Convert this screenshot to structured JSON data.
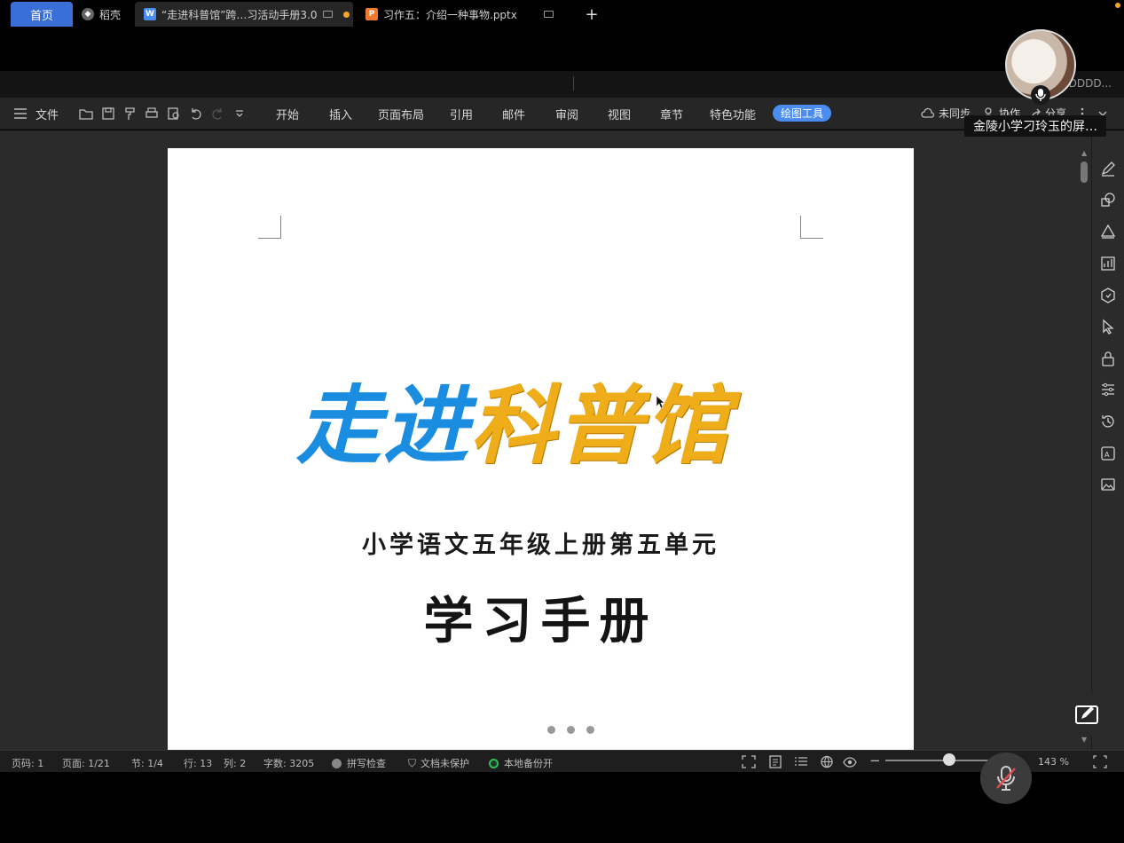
{
  "tabs": {
    "home": "首页",
    "daoke": "稻壳",
    "doc": "“走进科普馆”跨…习活动手册3.0",
    "ppt": "习作五：介绍一种事物.pptx",
    "new_tab": "+"
  },
  "account_text": "DDDD...",
  "toolbar": {
    "file": "文件",
    "menus": [
      "开始",
      "插入",
      "页面布局",
      "引用",
      "邮件",
      "审阅",
      "视图",
      "章节",
      "特色功能"
    ],
    "active_menu": "绘图工具",
    "sync": "未同步",
    "collab": "协作",
    "share": "分享"
  },
  "document": {
    "hero_blue": "走进",
    "hero_gold": "科普馆",
    "subtitle": "小学语文五年级上册第五单元",
    "main_title": "学习手册"
  },
  "statusbar": {
    "page_code": "页码: 1",
    "page": "页面: 1/21",
    "section": "节: 1/4",
    "row": "行: 13",
    "col": "列: 2",
    "words": "字数: 3205",
    "spell": "拼写检查",
    "protect": "文档未保护",
    "backup": "本地备份开",
    "zoom": "143 %"
  },
  "zoom_level": 143,
  "meeting": {
    "sharer_label": "金陵小学刁玲玉的屏…"
  },
  "colors": {
    "accent": "#4a8cf0",
    "hero_blue": "#1a8de0",
    "hero_gold": "#f0ad1a",
    "unsaved_dot": "#f5a623",
    "backup_dot": "#2fbf5a"
  }
}
